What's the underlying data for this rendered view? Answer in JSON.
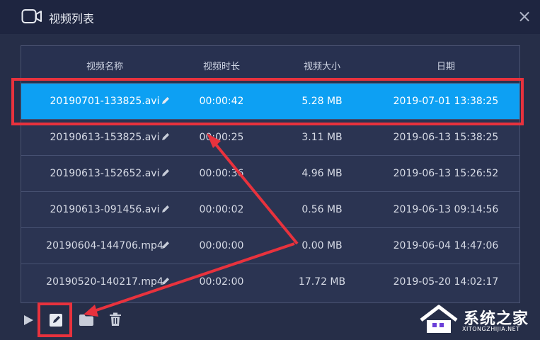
{
  "window": {
    "title": "视频列表",
    "close_glyph": "×"
  },
  "table": {
    "headers": [
      "视频名称",
      "视频时长",
      "视频大小",
      "日期"
    ],
    "rows": [
      {
        "name": "20190701-133825.avi",
        "duration": "00:00:42",
        "size": "5.28 MB",
        "date": "2019-07-01 13:38:25",
        "selected": true
      },
      {
        "name": "20190613-153825.avi",
        "duration": "00:00:25",
        "size": "3.11 MB",
        "date": "2019-06-13 15:38:25",
        "selected": false
      },
      {
        "name": "20190613-152652.avi",
        "duration": "00:00:36",
        "size": "4.96 MB",
        "date": "2019-06-13 15:26:52",
        "selected": false
      },
      {
        "name": "20190613-091456.avi",
        "duration": "00:00:02",
        "size": "0.56 MB",
        "date": "2019-06-13 09:14:56",
        "selected": false
      },
      {
        "name": "20190604-144706.mp4",
        "duration": "00:00:00",
        "size": "0.00 MB",
        "date": "2019-06-04 14:47:06",
        "selected": false
      },
      {
        "name": "20190520-140217.mp4",
        "duration": "00:02:00",
        "size": "17.72 MB",
        "date": "2019-05-20 14:02:17",
        "selected": false
      }
    ]
  },
  "toolbar": {
    "icons": [
      "play-icon",
      "rename-icon",
      "folder-icon",
      "trash-icon"
    ]
  },
  "watermark": {
    "text": "系统之家",
    "subtext": "XITONGZHIJIA.NET"
  },
  "colors": {
    "background": "#262e48",
    "titlebar": "#1e2540",
    "selected_row": "#0da0f3",
    "annotation_red": "#e8323d"
  }
}
